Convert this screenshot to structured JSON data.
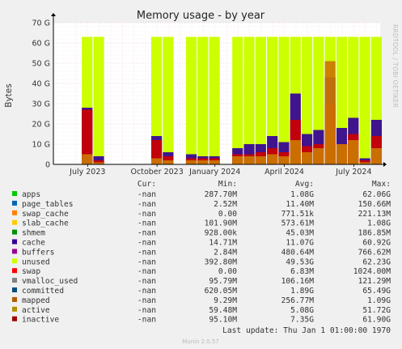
{
  "chart_data": {
    "type": "area",
    "title": "Memory usage - by year",
    "ylabel": "Bytes",
    "side_label": "RRDTOOL / TOBI OETIKER",
    "footer": "Munin 2.0.57",
    "ylim": [
      0,
      70
    ],
    "y_unit": "G",
    "y_ticks": [
      "0",
      "10 G",
      "20 G",
      "30 G",
      "40 G",
      "50 G",
      "60 G",
      "70 G"
    ],
    "x_ticks": [
      "July 2023",
      "October 2023",
      "January 2024",
      "April 2024",
      "July 2024"
    ],
    "grid": true,
    "x": [
      "2023-06",
      "2023-07",
      "2023-07b",
      "2023-08",
      "2023-08b",
      "2023-09",
      "2023-09b",
      "2023-10",
      "2023-10b",
      "2023-11",
      "2023-11b",
      "2023-12",
      "2024-01",
      "2024-01b",
      "2024-02",
      "2024-02b",
      "2024-03",
      "2024-03b",
      "2024-04",
      "2024-04b",
      "2024-05",
      "2024-05b",
      "2024-06",
      "2024-06b",
      "2024-07",
      "2024-07b",
      "2024-08"
    ],
    "series": [
      {
        "name": "unused",
        "color": "#ccff00",
        "values": [
          0,
          63,
          63,
          0,
          0,
          0,
          0,
          63,
          63,
          0,
          63,
          63,
          63,
          0,
          63,
          63,
          63,
          63,
          63,
          63,
          63,
          63,
          63,
          63,
          63,
          63,
          63
        ]
      },
      {
        "name": "cache",
        "color": "#330099",
        "values": [
          0,
          28,
          4,
          0,
          0,
          0,
          0,
          14,
          6,
          0,
          5,
          4,
          4,
          0,
          8,
          10,
          10,
          14,
          11,
          35,
          15,
          17,
          43,
          18,
          23,
          3,
          22
        ]
      },
      {
        "name": "apps",
        "color": "#00cc00",
        "values": [
          0,
          3,
          1,
          0,
          0,
          0,
          0,
          1,
          1,
          0,
          1,
          1,
          1,
          0,
          1,
          1,
          1,
          1,
          1,
          2,
          1,
          1,
          2,
          1,
          2,
          1,
          2
        ]
      },
      {
        "name": "inactive",
        "color": "#cc0000",
        "values": [
          0,
          27,
          2,
          0,
          0,
          0,
          0,
          12,
          4,
          0,
          3,
          3,
          3,
          0,
          5,
          5,
          6,
          8,
          6,
          22,
          9,
          10,
          30,
          10,
          15,
          2,
          14
        ]
      },
      {
        "name": "active",
        "color": "#cc7700",
        "values": [
          0,
          5,
          1,
          0,
          0,
          0,
          0,
          3,
          2,
          0,
          2,
          2,
          2,
          0,
          4,
          4,
          4,
          5,
          4,
          12,
          6,
          8,
          51,
          10,
          12,
          1,
          8
        ]
      }
    ],
    "legend_header": [
      "Cur:",
      "Min:",
      "Avg:",
      "Max:"
    ],
    "legend": [
      {
        "name": "apps",
        "color": "#00cc00",
        "cur": "-nan",
        "min": "287.70M",
        "avg": "1.08G",
        "max": "62.06G"
      },
      {
        "name": "page_tables",
        "color": "#0066b3",
        "cur": "-nan",
        "min": "2.52M",
        "avg": "11.40M",
        "max": "150.66M"
      },
      {
        "name": "swap_cache",
        "color": "#ff8000",
        "cur": "-nan",
        "min": "0.00",
        "avg": "771.51k",
        "max": "221.13M"
      },
      {
        "name": "slab_cache",
        "color": "#ffcc00",
        "cur": "-nan",
        "min": "101.90M",
        "avg": "573.61M",
        "max": "1.08G"
      },
      {
        "name": "shmem",
        "color": "#008f00",
        "cur": "-nan",
        "min": "928.00k",
        "avg": "45.03M",
        "max": "186.85M"
      },
      {
        "name": "cache",
        "color": "#330099",
        "cur": "-nan",
        "min": "14.71M",
        "avg": "11.07G",
        "max": "60.92G"
      },
      {
        "name": "buffers",
        "color": "#990099",
        "cur": "-nan",
        "min": "2.84M",
        "avg": "480.64M",
        "max": "766.62M"
      },
      {
        "name": "unused",
        "color": "#ccff00",
        "cur": "-nan",
        "min": "392.80M",
        "avg": "49.53G",
        "max": "62.23G"
      },
      {
        "name": "swap",
        "color": "#ff0000",
        "cur": "-nan",
        "min": "0.00",
        "avg": "6.83M",
        "max": "1024.00M"
      },
      {
        "name": "vmalloc_used",
        "color": "#808080",
        "cur": "-nan",
        "min": "95.79M",
        "avg": "106.16M",
        "max": "121.29M"
      },
      {
        "name": "committed",
        "color": "#004d80",
        "cur": "-nan",
        "min": "620.05M",
        "avg": "1.89G",
        "max": "65.49G"
      },
      {
        "name": "mapped",
        "color": "#b35a00",
        "cur": "-nan",
        "min": "9.29M",
        "avg": "256.77M",
        "max": "1.09G"
      },
      {
        "name": "active",
        "color": "#b38f00",
        "cur": "-nan",
        "min": "59.48M",
        "avg": "5.08G",
        "max": "51.72G"
      },
      {
        "name": "inactive",
        "color": "#a00000",
        "cur": "-nan",
        "min": "95.10M",
        "avg": "7.35G",
        "max": "61.90G"
      }
    ],
    "last_update": "Last update: Thu Jan  1 01:00:00 1970"
  }
}
